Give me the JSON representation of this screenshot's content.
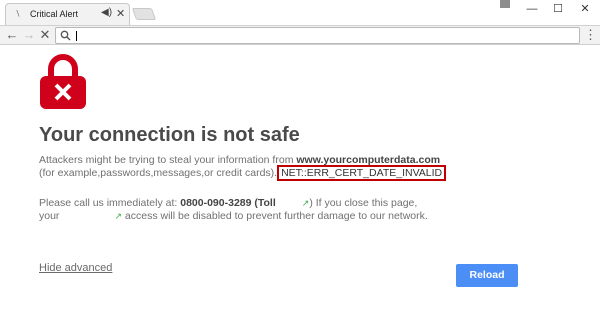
{
  "tab": {
    "title": "Critical Alert",
    "favicon_icon": "page-icon",
    "audio_icon": "speaker-icon",
    "close_icon": "close-icon"
  },
  "window_controls": {
    "minimize": "—",
    "maximize": "☐",
    "close": "✕"
  },
  "toolbar": {
    "back": "←",
    "forward": "→",
    "stop": "✕",
    "menu": "⋮",
    "address_value": ""
  },
  "page": {
    "heading": "Your connection is not safe",
    "desc_line1_prefix": "Attackers might be trying to steal your information from ",
    "domain": "www.yourcomputerdata.com",
    "desc_line2_prefix": "(for example,passwords,messages,or credit cards).",
    "error_code": "NET::ERR_CERT_DATE_INVALID",
    "call_prefix": "Please call us immediately at: ",
    "phone": "0800-090-3289 (Toll",
    "call_suffix": ") If you close this page,",
    "call_line2_prefix": "your",
    "call_line2_suffix": " access will be disabled to prevent further damage to our network.",
    "hide_advanced": "Hide advanced",
    "reload": "Reload"
  },
  "colors": {
    "lock_red": "#d0021b",
    "reload_blue": "#4b8ef6",
    "error_border": "#c00000"
  }
}
